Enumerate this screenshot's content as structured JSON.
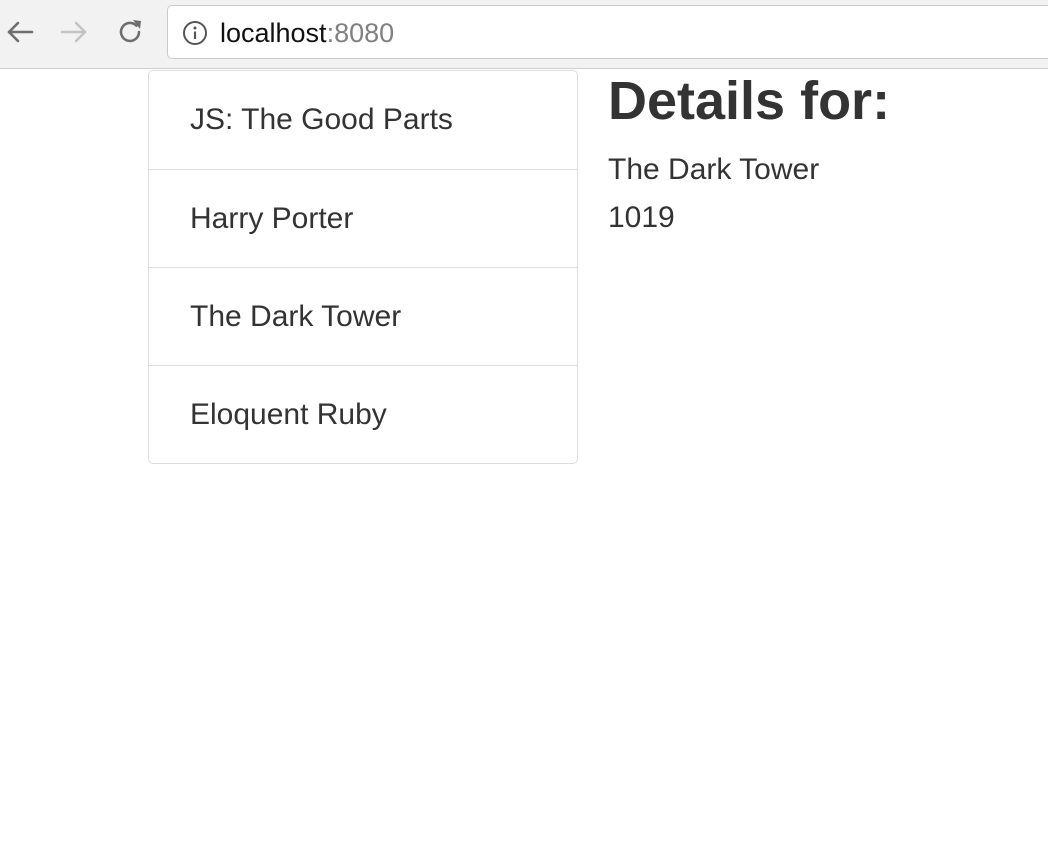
{
  "browser": {
    "url_host": "localhost",
    "url_port": ":8080",
    "icons": [
      "back-arrow-icon",
      "forward-arrow-icon",
      "reload-icon",
      "info-icon"
    ]
  },
  "book_list": {
    "items": [
      {
        "label": "JS: The Good Parts"
      },
      {
        "label": "Harry Porter"
      },
      {
        "label": "The Dark Tower"
      },
      {
        "label": "Eloquent Ruby"
      }
    ]
  },
  "details": {
    "heading": "Details for:",
    "title": "The Dark Tower",
    "pages": "1019"
  },
  "colors": {
    "text": "#333333",
    "border": "#dddddd",
    "toolbar": "#f2f2f2"
  }
}
